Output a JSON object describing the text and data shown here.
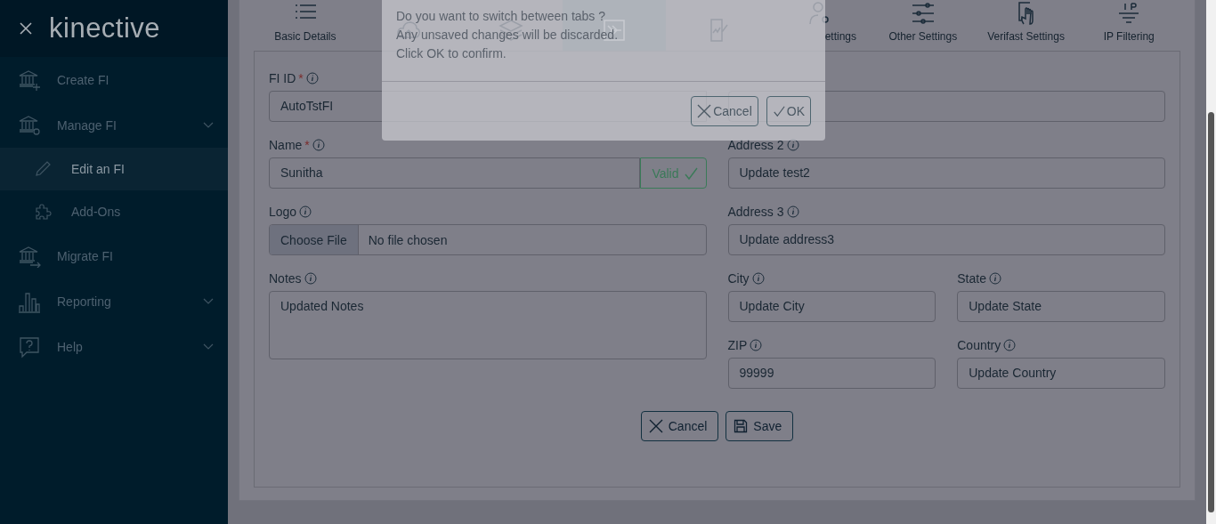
{
  "sidebar": {
    "logo": "kinective",
    "items": [
      {
        "label": "Create FI",
        "expandable": false,
        "selected": false
      },
      {
        "label": "Manage FI",
        "expandable": true,
        "selected": false,
        "children": [
          {
            "label": "Edit an FI",
            "selected": true
          },
          {
            "label": "Add-Ons",
            "selected": false
          }
        ]
      },
      {
        "label": "Migrate FI",
        "expandable": false,
        "selected": false
      },
      {
        "label": "Reporting",
        "expandable": true,
        "selected": false
      },
      {
        "label": "Help",
        "expandable": true,
        "selected": false
      }
    ]
  },
  "tabs": [
    {
      "label": "Basic Details",
      "selected": false
    },
    {
      "selected": false
    },
    {
      "selected": false
    },
    {
      "selected": true
    },
    {
      "selected": false
    },
    {
      "label": "ettings",
      "cut": true,
      "selected": false
    },
    {
      "label": "Other Settings",
      "selected": false
    },
    {
      "label": "Verifast Settings",
      "selected": false
    },
    {
      "label": "IP Filtering",
      "selected": false
    }
  ],
  "form": {
    "required_mark": "*",
    "left_fields": [
      {
        "label": "FI ID",
        "required": true,
        "kind": "text",
        "value": "AutoTstFI"
      },
      {
        "label": "Name",
        "required": true,
        "kind": "text",
        "value": "Sunitha",
        "status": "Valid"
      },
      {
        "label": "Logo",
        "required": false,
        "kind": "file",
        "button": "Choose File",
        "value": "No file chosen"
      },
      {
        "label": "Notes",
        "required": false,
        "kind": "textarea",
        "value": "Updated Notes"
      }
    ],
    "right_rows": [
      {
        "fields": [
          {
            "covered": true
          }
        ]
      },
      {
        "fields": [
          {
            "label": "Address 2",
            "value": "Update test2"
          }
        ]
      },
      {
        "fields": [
          {
            "label": "Address 3",
            "value": "Update address3"
          }
        ]
      },
      {
        "fields": [
          {
            "label": "City",
            "value": "Update City"
          },
          {
            "label": "State",
            "value": "Update State"
          }
        ]
      },
      {
        "fields": [
          {
            "label": "ZIP",
            "value": "99999"
          },
          {
            "label": "Country",
            "value": "Update Country"
          }
        ]
      }
    ],
    "buttons": [
      {
        "label": "Cancel",
        "kind": "cancel"
      },
      {
        "label": "Save",
        "kind": "save"
      }
    ]
  },
  "dialog": {
    "lines": [
      "Do you want to switch between tabs ?",
      "Any unsaved changes will be discarded.",
      "Click OK to confirm."
    ],
    "buttons": [
      {
        "label": "Cancel",
        "kind": "cancel"
      },
      {
        "label": "OK",
        "kind": "ok"
      }
    ]
  }
}
